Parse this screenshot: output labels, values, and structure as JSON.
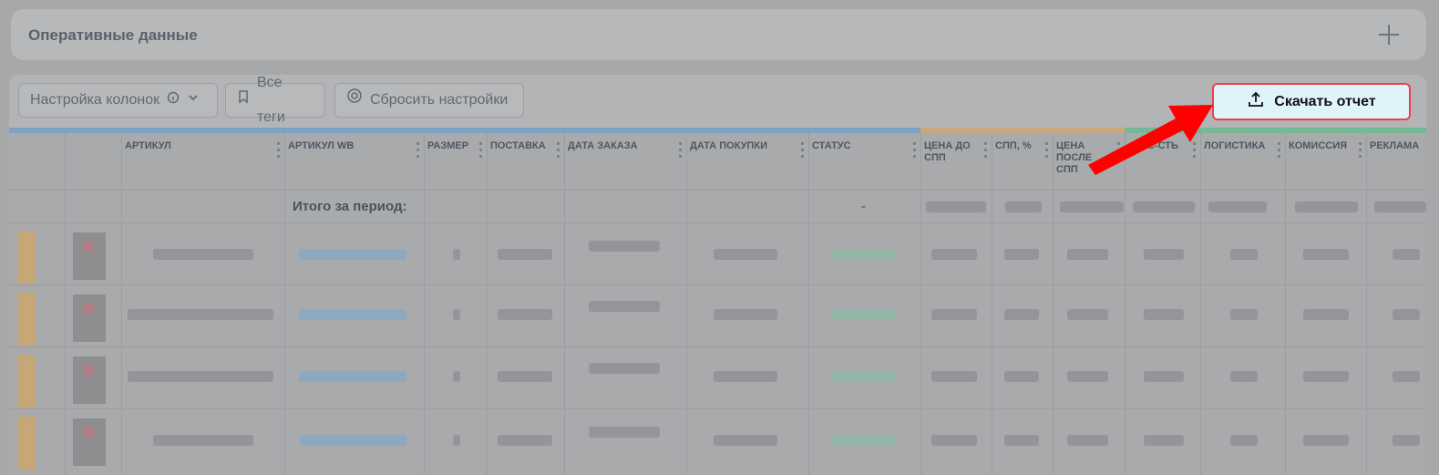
{
  "header": {
    "title": "Оперативные данные"
  },
  "toolbar": {
    "columns_label": "Настройка колонок",
    "tags_label": "Все теги",
    "reset_label": "Сбросить настройки",
    "download_label": "Скачать отчет"
  },
  "table": {
    "columns": [
      "Артикул",
      "Артикул WB",
      "Размер",
      "Поставка",
      "Дата заказа",
      "Дата покупки",
      "Статус",
      "Цена до СПП",
      "СПП, %",
      "Цена после СПП",
      "с-сть",
      "Логистика",
      "Комиссия",
      "Реклама"
    ],
    "total_label": "Итого за период:",
    "total_status": "-"
  },
  "colors": {
    "group_blue": "#7ea2c3",
    "group_tan": "#c7a97d",
    "group_green": "#74b896",
    "highlight": "#ef3f46"
  },
  "icons": [
    "info-icon",
    "chevron-down-icon",
    "bookmark-icon",
    "gear-icon",
    "upload-icon",
    "plus-icon"
  ]
}
